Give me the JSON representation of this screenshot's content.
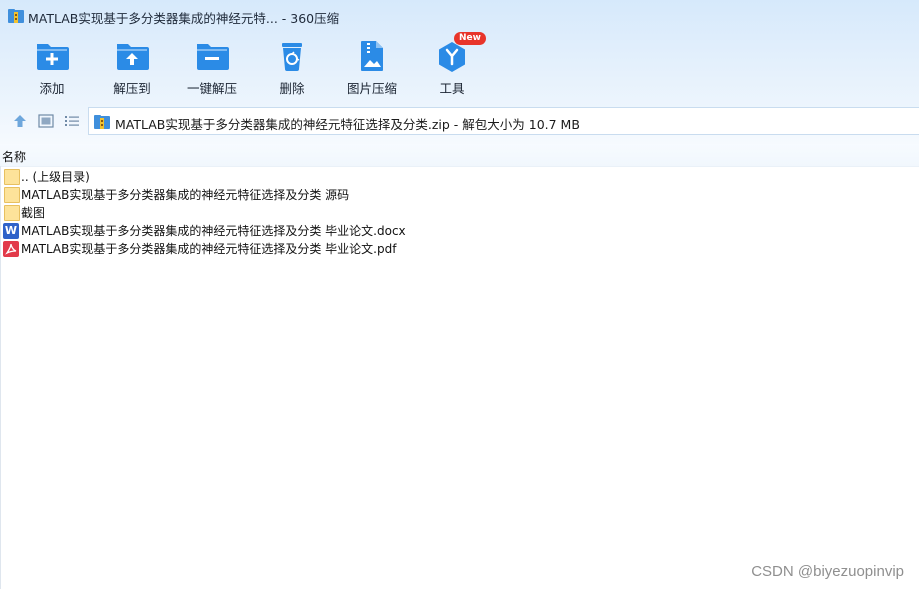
{
  "window": {
    "title": "MATLAB实现基于多分类器集成的神经元特... - 360压缩",
    "app_icon": "archive-icon"
  },
  "toolbar": {
    "items": [
      {
        "label": "添加",
        "icon": "add-folder-icon"
      },
      {
        "label": "解压到",
        "icon": "extract-to-icon"
      },
      {
        "label": "一键解压",
        "icon": "one-click-extract-icon"
      },
      {
        "label": "删除",
        "icon": "recycle-bin-icon"
      },
      {
        "label": "图片压缩",
        "icon": "image-compress-icon"
      },
      {
        "label": "工具",
        "icon": "tools-icon",
        "badge": "New"
      }
    ]
  },
  "nav": {
    "path": "MATLAB实现基于多分类器集成的神经元特征选择及分类.zip - 解包大小为 10.7 MB"
  },
  "list": {
    "column_name": "名称",
    "files": [
      {
        "name": ".. (上级目录)",
        "type": "folder"
      },
      {
        "name": "MATLAB实现基于多分类器集成的神经元特征选择及分类 源码",
        "type": "folder"
      },
      {
        "name": "截图",
        "type": "folder"
      },
      {
        "name": "MATLAB实现基于多分类器集成的神经元特征选择及分类 毕业论文.docx",
        "type": "word"
      },
      {
        "name": "MATLAB实现基于多分类器集成的神经元特征选择及分类 毕业论文.pdf",
        "type": "pdf"
      }
    ]
  },
  "watermark": "CSDN @biyezuopinvip",
  "colors": {
    "accent": "#2b8be6",
    "badge": "#e8342a",
    "folder": "#fde39a",
    "word": "#2f62c9",
    "pdf": "#e23a4a"
  }
}
